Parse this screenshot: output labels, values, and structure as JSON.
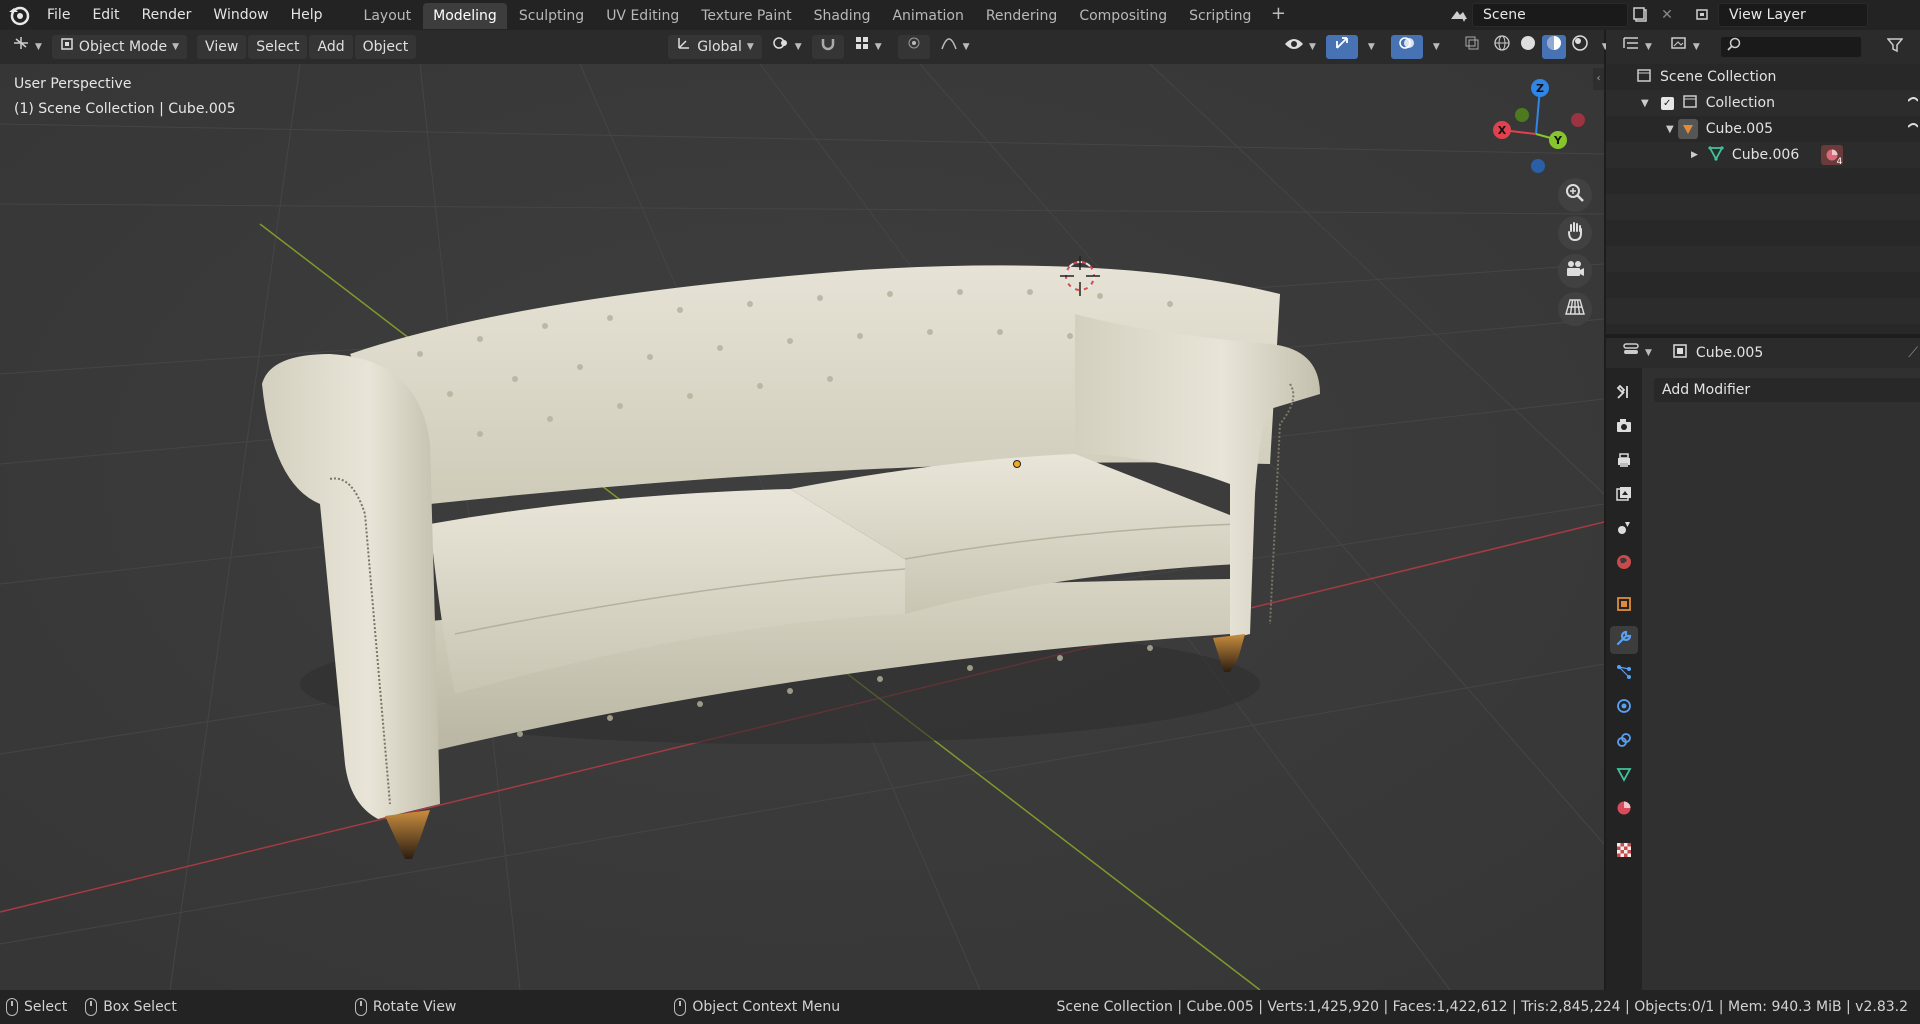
{
  "menus": [
    "File",
    "Edit",
    "Render",
    "Window",
    "Help"
  ],
  "workspaces": [
    {
      "label": "Layout",
      "active": false
    },
    {
      "label": "Modeling",
      "active": true
    },
    {
      "label": "Sculpting",
      "active": false
    },
    {
      "label": "UV Editing",
      "active": false
    },
    {
      "label": "Texture Paint",
      "active": false
    },
    {
      "label": "Shading",
      "active": false
    },
    {
      "label": "Animation",
      "active": false
    },
    {
      "label": "Rendering",
      "active": false
    },
    {
      "label": "Compositing",
      "active": false
    },
    {
      "label": "Scripting",
      "active": false
    }
  ],
  "scene": {
    "name": "Scene",
    "view_layer": "View Layer"
  },
  "viewport_header": {
    "mode": "Object Mode",
    "view": "View",
    "select": "Select",
    "add": "Add",
    "object": "Object",
    "transform_orientation": "Global"
  },
  "viewport": {
    "perspective": "User Perspective",
    "context": "(1) Scene Collection | Cube.005",
    "gizmo": {
      "x": "X",
      "y": "Y",
      "z": "Z"
    }
  },
  "outliner": {
    "search_placeholder": "",
    "root": "Scene Collection",
    "collection": "Collection",
    "object": "Cube.005",
    "child": "Cube.006",
    "material_count": "4"
  },
  "properties": {
    "object_name": "Cube.005",
    "add_modifier": "Add Modifier"
  },
  "statusbar": {
    "select": "Select",
    "box_select": "Box Select",
    "rotate_view": "Rotate View",
    "context_menu": "Object Context Menu",
    "stats": "Scene Collection | Cube.005 | Verts:1,425,920 | Faces:1,422,612 | Tris:2,845,224 | Objects:0/1 | Mem: 940.3 MiB | v2.83.2"
  },
  "colors": {
    "accent": "#4772b3",
    "axis_x": "#e0414e",
    "axis_y": "#86c52b",
    "axis_z": "#2f86e6",
    "sofa": "#ddd9c9"
  }
}
